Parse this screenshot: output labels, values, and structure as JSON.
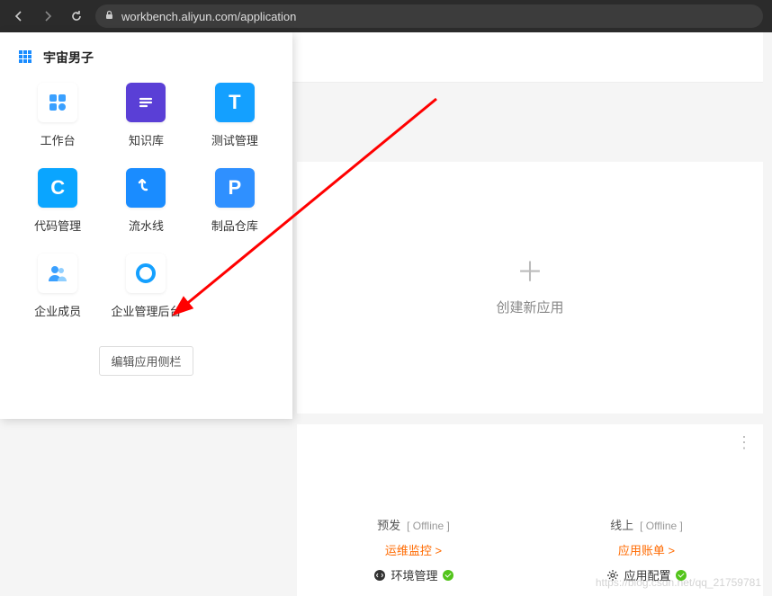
{
  "browser": {
    "url": "workbench.aliyun.com/application"
  },
  "dropdown": {
    "org_name": "宇宙男子",
    "apps": [
      {
        "label": "工作台",
        "icon": "workbench-icon"
      },
      {
        "label": "知识库",
        "icon": "knowledge-icon"
      },
      {
        "label": "测试管理",
        "icon": "test-icon"
      },
      {
        "label": "代码管理",
        "icon": "code-icon"
      },
      {
        "label": "流水线",
        "icon": "pipeline-icon"
      },
      {
        "label": "制品仓库",
        "icon": "artifact-icon"
      },
      {
        "label": "企业成员",
        "icon": "members-icon"
      },
      {
        "label": "企业管理后台",
        "icon": "admin-icon"
      }
    ],
    "edit_label": "编辑应用侧栏"
  },
  "main": {
    "create_label": "创建新应用",
    "env": {
      "pre": {
        "name": "预发",
        "status": "Offline"
      },
      "online": {
        "name": "线上",
        "status": "Offline"
      }
    },
    "links": {
      "ops": "运维监控 >",
      "bill": "应用账单 >"
    },
    "status": {
      "env_mgmt": "环境管理",
      "app_config": "应用配置"
    }
  },
  "watermark": "https://blog.csdn.net/qq_21759781"
}
